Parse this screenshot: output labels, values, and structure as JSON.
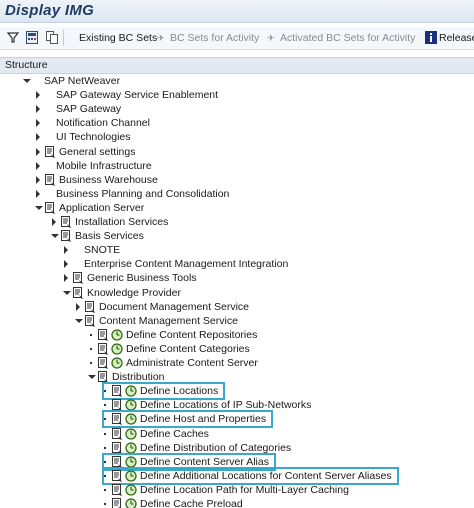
{
  "window": {
    "title": "Display IMG"
  },
  "toolbar": {
    "existing_bc_sets": "Existing BC Sets",
    "bc_sets_for_activity": "BC Sets for Activity",
    "activated_bc_sets": "Activated BC Sets for Activity",
    "release": "Release"
  },
  "tree_header": "Structure",
  "tree": [
    {
      "label": "SAP NetWeaver",
      "level": 0,
      "expander": "expanded",
      "icons": []
    },
    {
      "label": "SAP Gateway Service Enablement",
      "level": 1,
      "expander": "collapsed",
      "icons": []
    },
    {
      "label": "SAP Gateway",
      "level": 1,
      "expander": "collapsed",
      "icons": []
    },
    {
      "label": "Notification Channel",
      "level": 1,
      "expander": "collapsed",
      "icons": []
    },
    {
      "label": "UI Technologies",
      "level": 1,
      "expander": "collapsed",
      "icons": []
    },
    {
      "label": "General settings",
      "level": 1,
      "expander": "collapsed",
      "icons": [
        "doc"
      ]
    },
    {
      "label": "Mobile Infrastructure",
      "level": 1,
      "expander": "collapsed",
      "icons": []
    },
    {
      "label": "Business Warehouse",
      "level": 1,
      "expander": "collapsed",
      "icons": [
        "doc"
      ]
    },
    {
      "label": "Business Planning and Consolidation",
      "level": 1,
      "expander": "collapsed",
      "icons": []
    },
    {
      "label": "Application Server",
      "level": 1,
      "expander": "expanded",
      "icons": [
        "doc"
      ]
    },
    {
      "label": "Installation Services",
      "level": 2,
      "expander": "collapsed",
      "icons": [
        "doc"
      ]
    },
    {
      "label": "Basis Services",
      "level": 2,
      "expander": "expanded",
      "icons": [
        "doc"
      ]
    },
    {
      "label": "SNOTE",
      "level": 3,
      "expander": "collapsed",
      "icons": []
    },
    {
      "label": "Enterprise Content Management Integration",
      "level": 3,
      "expander": "collapsed",
      "icons": []
    },
    {
      "label": "Generic Business Tools",
      "level": 3,
      "expander": "collapsed",
      "icons": [
        "doc"
      ]
    },
    {
      "label": "Knowledge Provider",
      "level": 3,
      "expander": "expanded",
      "icons": [
        "doc"
      ]
    },
    {
      "label": "Document Management Service",
      "level": 4,
      "expander": "collapsed",
      "icons": [
        "doc"
      ]
    },
    {
      "label": "Content Management Service",
      "level": 4,
      "expander": "expanded",
      "icons": [
        "doc"
      ]
    },
    {
      "label": "Define Content Repositories",
      "level": 5,
      "expander": "bullet",
      "icons": [
        "doc",
        "clock"
      ]
    },
    {
      "label": "Define Content Categories",
      "level": 5,
      "expander": "bullet",
      "icons": [
        "doc",
        "clock"
      ]
    },
    {
      "label": "Administrate Content Server",
      "level": 5,
      "expander": "bullet",
      "icons": [
        "doc",
        "clock"
      ]
    },
    {
      "label": "Distribution",
      "level": 5,
      "expander": "expanded",
      "icons": [
        "doc"
      ]
    },
    {
      "label": "Define Locations",
      "level": 6,
      "expander": "bullet",
      "icons": [
        "doc",
        "clock"
      ],
      "highlight": true
    },
    {
      "label": "Define Locations of IP Sub-Networks",
      "level": 6,
      "expander": "bullet",
      "icons": [
        "doc",
        "clock"
      ]
    },
    {
      "label": "Define Host and Properties",
      "level": 6,
      "expander": "bullet",
      "icons": [
        "doc",
        "clock"
      ],
      "highlight": true
    },
    {
      "label": "Define Caches",
      "level": 6,
      "expander": "bullet",
      "icons": [
        "doc",
        "clock"
      ]
    },
    {
      "label": "Define Distribution of Categories",
      "level": 6,
      "expander": "bullet",
      "icons": [
        "doc",
        "clock"
      ]
    },
    {
      "label": "Define Content Server Alias",
      "level": 6,
      "expander": "bullet",
      "icons": [
        "doc",
        "clock"
      ],
      "highlight": true
    },
    {
      "label": "Define Additional Locations for Content Server Aliases",
      "level": 6,
      "expander": "bullet",
      "icons": [
        "doc",
        "clock"
      ],
      "highlight": true
    },
    {
      "label": "Define Location Path for Multi-Layer Caching",
      "level": 6,
      "expander": "bullet",
      "icons": [
        "doc",
        "clock"
      ]
    },
    {
      "label": "Define Cache Preload",
      "level": 6,
      "expander": "bullet",
      "icons": [
        "doc",
        "clock"
      ]
    }
  ],
  "colors": {
    "highlight": "#39a8c9",
    "title": "#1d3c62",
    "header_bg": "#e3e9f1"
  }
}
